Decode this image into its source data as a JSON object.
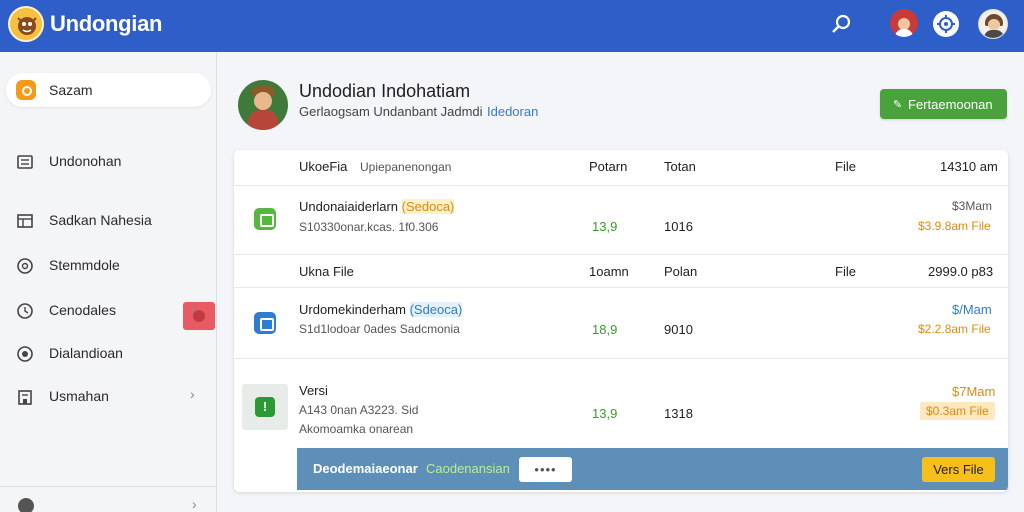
{
  "app": {
    "title": "Undongian"
  },
  "topbar": {
    "icons": [
      "search-icon",
      "user-avatar",
      "gear-icon",
      "profile-avatar"
    ]
  },
  "sidebar": {
    "items": [
      {
        "label": "Sazam",
        "icon": "orange-badge-icon",
        "active": true
      },
      {
        "label": "Undonohan",
        "icon": "book-icon"
      },
      {
        "label": "Sadkan Nahesia",
        "icon": "grid-icon"
      },
      {
        "label": "Stemmdole",
        "icon": "circle-icon"
      },
      {
        "label": "Cenodales",
        "icon": "clock-icon",
        "chevron": true
      },
      {
        "label": "Dialandioan",
        "icon": "circle-dot-icon"
      },
      {
        "label": "Usmahan",
        "icon": "building-icon",
        "chevron": true
      }
    ]
  },
  "header": {
    "title": "Undodian Indohatiam",
    "subtitle": "Gerlaogsam Undanbant Jadmdi",
    "subtitle_link": "Idedoran",
    "button_label": "Fertaemoonan"
  },
  "table": {
    "header": {
      "c1": "UkoeFia",
      "c1b": "Upiepanenongan",
      "c2": "Potarn",
      "c3": "Totan",
      "c4": "File",
      "c5": "14310 am"
    },
    "rows": [
      {
        "title": "Undonaiaiderlarn",
        "tag": "(Sedoca)",
        "sub": "S10330onar.kcas. 1f0.306",
        "v1": "13,9",
        "v2": "1016",
        "price_top": "$3Mam",
        "price_bottom": "$3.9.8am File"
      },
      {
        "divider": {
          "c1": "Ukna File",
          "c2": "1oamn",
          "c3": "Polan",
          "c4": "File",
          "c5": "2999.0 p83"
        }
      },
      {
        "title": "Urdomekinderham",
        "tag": "(Sdeoca)",
        "sub": "S1d1lodoar 0ades Sadcmonia",
        "v1": "18,9",
        "v2": "9010",
        "price_top": "$/Mam",
        "price_bottom": "$2.2.8am File"
      },
      {
        "title": "Versi",
        "sub": "A143 0nan A3223. Sid",
        "sub2": "Akomoamka onarean",
        "v1": "13,9",
        "v2": "1318",
        "price_top": "$7Mam",
        "price_bottom": "$0.3am File"
      }
    ]
  },
  "bottom_bar": {
    "left_label": "Deodemaiaeonar",
    "status": "Caodenansian",
    "dots": "••••",
    "button_label": "Vers File"
  }
}
